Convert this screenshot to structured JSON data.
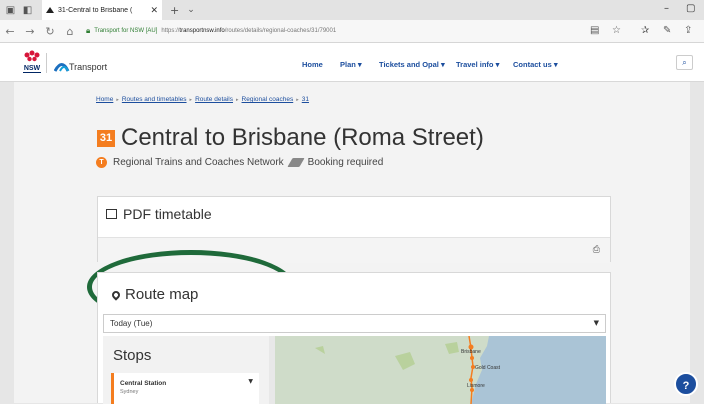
{
  "browser": {
    "tab_title": "31-Central to Brisbane (",
    "url_site_label": "Transport for NSW [AU]",
    "url_prefix": "https://",
    "url_host": "transportnsw.info",
    "url_path": "/routes/details/regional-coaches/31/79001"
  },
  "header": {
    "brand": "Transport",
    "nav": {
      "home": "Home",
      "plan": "Plan ▾",
      "tickets": "Tickets and Opal ▾",
      "travel": "Travel info ▾",
      "contact": "Contact us ▾"
    }
  },
  "breadcrumb": [
    "Home",
    "Routes and timetables",
    "Route details",
    "Regional coaches",
    "31"
  ],
  "route": {
    "number": "31",
    "title": "Central to Brisbane (Roma Street)",
    "network_icon_letter": "T",
    "network": "Regional Trains and Coaches Network",
    "booking": "Booking required"
  },
  "pdf_timetable": {
    "heading": "PDF timetable"
  },
  "route_map": {
    "heading": "Route map",
    "day_selected": "Today (Tue)",
    "stops_heading": "Stops",
    "first_stop": {
      "name": "Central Station",
      "suburb": "Sydney"
    },
    "map_labels": {
      "brisbane": "Brisbane",
      "gold_coast": "Gold Coast",
      "lismore": "Lismore"
    }
  },
  "help_label": "?",
  "colors": {
    "accent_orange": "#f47d1f",
    "nav_blue": "#1c4e9e",
    "highlight_green": "#1f6a3a"
  }
}
